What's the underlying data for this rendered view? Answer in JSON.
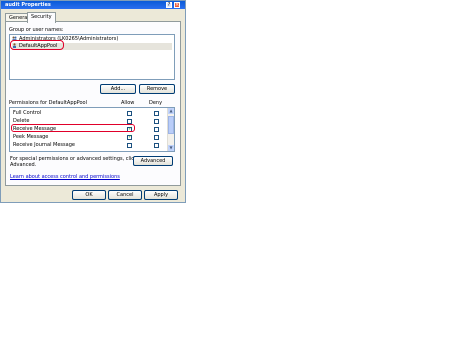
{
  "window": {
    "title": "audit Properties",
    "help_button": "?",
    "close_button": "×"
  },
  "tabs": [
    {
      "label": "General",
      "active": false
    },
    {
      "label": "Security",
      "active": true
    }
  ],
  "groups": {
    "label": "Group or user names:",
    "items": [
      {
        "name": "Administrators (LK0265\\Administrators)",
        "selected": false
      },
      {
        "name": "DefaultAppPool",
        "selected": true
      }
    ],
    "add_label": "Add...",
    "remove_label": "Remove"
  },
  "permissions": {
    "label": "Permissions for DefaultAppPool",
    "allow_header": "Allow",
    "deny_header": "Deny",
    "rows": [
      {
        "name": "Full Control",
        "allow": false,
        "deny": false
      },
      {
        "name": "Delete",
        "allow": false,
        "deny": false
      },
      {
        "name": "Receive Message",
        "allow": true,
        "deny": false
      },
      {
        "name": "Peek Message",
        "allow": true,
        "deny": false
      },
      {
        "name": "Receive Journal Message",
        "allow": false,
        "deny": false
      }
    ]
  },
  "special": {
    "text_line1": "For special permissions or advanced settings, click",
    "text_line2": "Advanced.",
    "advanced_label": "Advanced"
  },
  "learn_link": "Learn about access control and permissions",
  "footer": {
    "ok_label": "OK",
    "cancel_label": "Cancel",
    "apply_label": "Apply"
  },
  "colors": {
    "highlight": "#e0002a",
    "titlebar": "#0a5bd8",
    "check": "#21a121"
  }
}
